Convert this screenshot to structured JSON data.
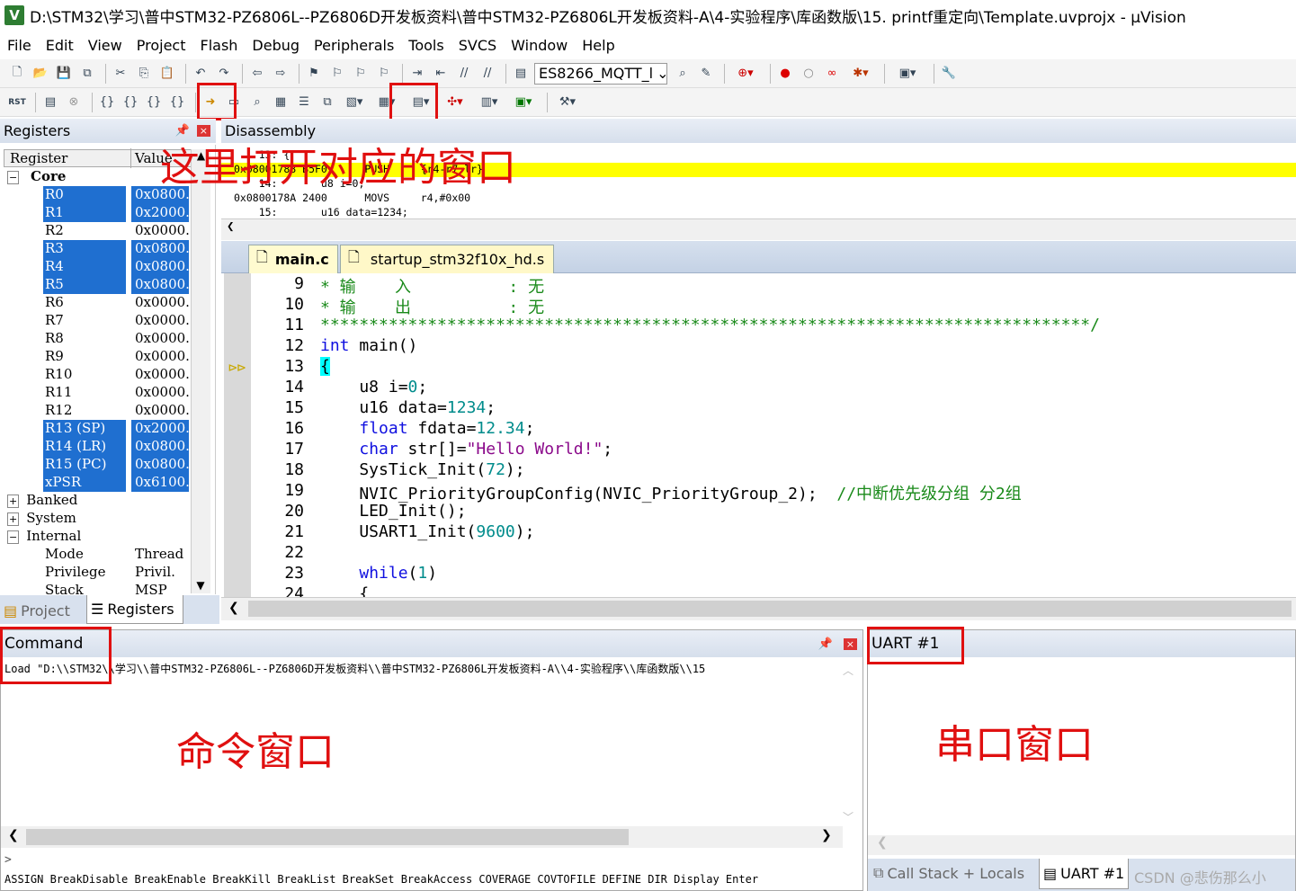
{
  "window": {
    "title": "D:\\STM32\\学习\\普中STM32-PZ6806L--PZ6806D开发板资料\\普中STM32-PZ6806L开发板资料-A\\4-实验程序\\库函数版\\15. printf重定向\\Template.uvprojx - µVision",
    "icon_letter": "V"
  },
  "menu": [
    "File",
    "Edit",
    "View",
    "Project",
    "Flash",
    "Debug",
    "Peripherals",
    "Tools",
    "SVCS",
    "Window",
    "Help"
  ],
  "toolbar": {
    "target_combo": "ES8266_MQTT_l"
  },
  "annotations": {
    "open_windows": "这里打开对应的窗口",
    "command_window": "命令窗口",
    "serial_window": "串口窗口"
  },
  "registers": {
    "title": "Registers",
    "col_register": "Register",
    "col_value": "Value",
    "group_core": "Core",
    "rows": [
      {
        "name": "R0",
        "value": "0x0800.",
        "selected": true
      },
      {
        "name": "R1",
        "value": "0x2000.",
        "selected": true
      },
      {
        "name": "R2",
        "value": "0x0000.",
        "selected": false
      },
      {
        "name": "R3",
        "value": "0x0800.",
        "selected": true
      },
      {
        "name": "R4",
        "value": "0x0800.",
        "selected": true
      },
      {
        "name": "R5",
        "value": "0x0800.",
        "selected": true
      },
      {
        "name": "R6",
        "value": "0x0000.",
        "selected": false
      },
      {
        "name": "R7",
        "value": "0x0000.",
        "selected": false
      },
      {
        "name": "R8",
        "value": "0x0000.",
        "selected": false
      },
      {
        "name": "R9",
        "value": "0x0000.",
        "selected": false
      },
      {
        "name": "R10",
        "value": "0x0000.",
        "selected": false
      },
      {
        "name": "R11",
        "value": "0x0000.",
        "selected": false
      },
      {
        "name": "R12",
        "value": "0x0000.",
        "selected": false
      },
      {
        "name": "R13 (SP)",
        "value": "0x2000.",
        "selected": true
      },
      {
        "name": "R14 (LR)",
        "value": "0x0800.",
        "selected": true
      },
      {
        "name": "R15 (PC)",
        "value": "0x0800.",
        "selected": true
      },
      {
        "name": "xPSR",
        "value": "0x6100.",
        "selected": true
      }
    ],
    "groups": [
      "Banked",
      "System",
      "Internal"
    ],
    "internal_rows": [
      {
        "name": "Mode",
        "value": "Thread"
      },
      {
        "name": "Privilege",
        "value": "Privil."
      },
      {
        "name": "Stack",
        "value": "MSP"
      }
    ]
  },
  "bottom_tabs": {
    "project": "Project",
    "registers": "Registers"
  },
  "disassembly": {
    "title": "Disassembly",
    "lines": [
      "    13: {",
      "0x08001788 B5F0      PUSH     {r4-r7,lr}",
      "    14:       u8 i=0;",
      "0x0800178A 2400      MOVS     r4,#0x00",
      "    15:       u16 data=1234;"
    ],
    "highlight_index": 1
  },
  "editor": {
    "tabs": [
      "main.c",
      "startup_stm32f10x_hd.s"
    ],
    "lines": [
      {
        "n": "9",
        "segs": [
          {
            "t": "* 输    入          : 无",
            "c": "zh"
          }
        ]
      },
      {
        "n": "10",
        "segs": [
          {
            "t": "* 输    出          : 无",
            "c": "zh"
          }
        ]
      },
      {
        "n": "11",
        "segs": [
          {
            "t": "*******************************************************************************/",
            "c": "cmt"
          }
        ]
      },
      {
        "n": "12",
        "segs": [
          {
            "t": "int",
            "c": "kw"
          },
          {
            "t": " main()",
            "c": ""
          }
        ]
      },
      {
        "n": "13",
        "segs": [
          {
            "t": "{",
            "c": "brace"
          }
        ]
      },
      {
        "n": "14",
        "segs": [
          {
            "t": "    u8 i=",
            "c": ""
          },
          {
            "t": "0",
            "c": "num"
          },
          {
            "t": ";",
            "c": ""
          }
        ]
      },
      {
        "n": "15",
        "segs": [
          {
            "t": "    u16 data=",
            "c": ""
          },
          {
            "t": "1234",
            "c": "num"
          },
          {
            "t": ";",
            "c": ""
          }
        ]
      },
      {
        "n": "16",
        "segs": [
          {
            "t": "    ",
            "c": ""
          },
          {
            "t": "float",
            "c": "kw"
          },
          {
            "t": " fdata=",
            "c": ""
          },
          {
            "t": "12.34",
            "c": "num"
          },
          {
            "t": ";",
            "c": ""
          }
        ]
      },
      {
        "n": "17",
        "segs": [
          {
            "t": "    ",
            "c": ""
          },
          {
            "t": "char",
            "c": "kw"
          },
          {
            "t": " str[]=",
            "c": ""
          },
          {
            "t": "\"Hello World!\"",
            "c": "str"
          },
          {
            "t": ";",
            "c": ""
          }
        ]
      },
      {
        "n": "18",
        "segs": [
          {
            "t": "    SysTick_Init(",
            "c": ""
          },
          {
            "t": "72",
            "c": "num"
          },
          {
            "t": ");",
            "c": ""
          }
        ]
      },
      {
        "n": "19",
        "segs": [
          {
            "t": "    NVIC_PriorityGroupConfig(NVIC_PriorityGroup_2);  ",
            "c": ""
          },
          {
            "t": "//中断优先级分组 分2组",
            "c": "cmt"
          }
        ]
      },
      {
        "n": "20",
        "segs": [
          {
            "t": "    LED_Init();",
            "c": ""
          }
        ]
      },
      {
        "n": "21",
        "segs": [
          {
            "t": "    USART1_Init(",
            "c": ""
          },
          {
            "t": "9600",
            "c": "num"
          },
          {
            "t": ");",
            "c": ""
          }
        ]
      },
      {
        "n": "22",
        "segs": [
          {
            "t": "",
            "c": ""
          }
        ]
      },
      {
        "n": "23",
        "segs": [
          {
            "t": "    ",
            "c": ""
          },
          {
            "t": "while",
            "c": "kw"
          },
          {
            "t": "(",
            "c": ""
          },
          {
            "t": "1",
            "c": "num"
          },
          {
            "t": ")",
            "c": ""
          }
        ]
      },
      {
        "n": "24",
        "segs": [
          {
            "t": "    {",
            "c": ""
          }
        ]
      }
    ]
  },
  "command": {
    "title": "Command",
    "output": "Load \"D:\\\\STM32\\\\学习\\\\普中STM32-PZ6806L--PZ6806D开发板资料\\\\普中STM32-PZ6806L开发板资料-A\\\\4-实验程序\\\\库函数版\\\\15",
    "prompt": ">",
    "hints": "ASSIGN BreakDisable BreakEnable BreakKill BreakList BreakSet BreakAccess COVERAGE COVTOFILE DEFINE DIR Display Enter"
  },
  "uart": {
    "title": "UART #1",
    "tabs": [
      "Call Stack + Locals",
      "UART #1"
    ],
    "watermark": "CSDN @悲伤那么小"
  }
}
